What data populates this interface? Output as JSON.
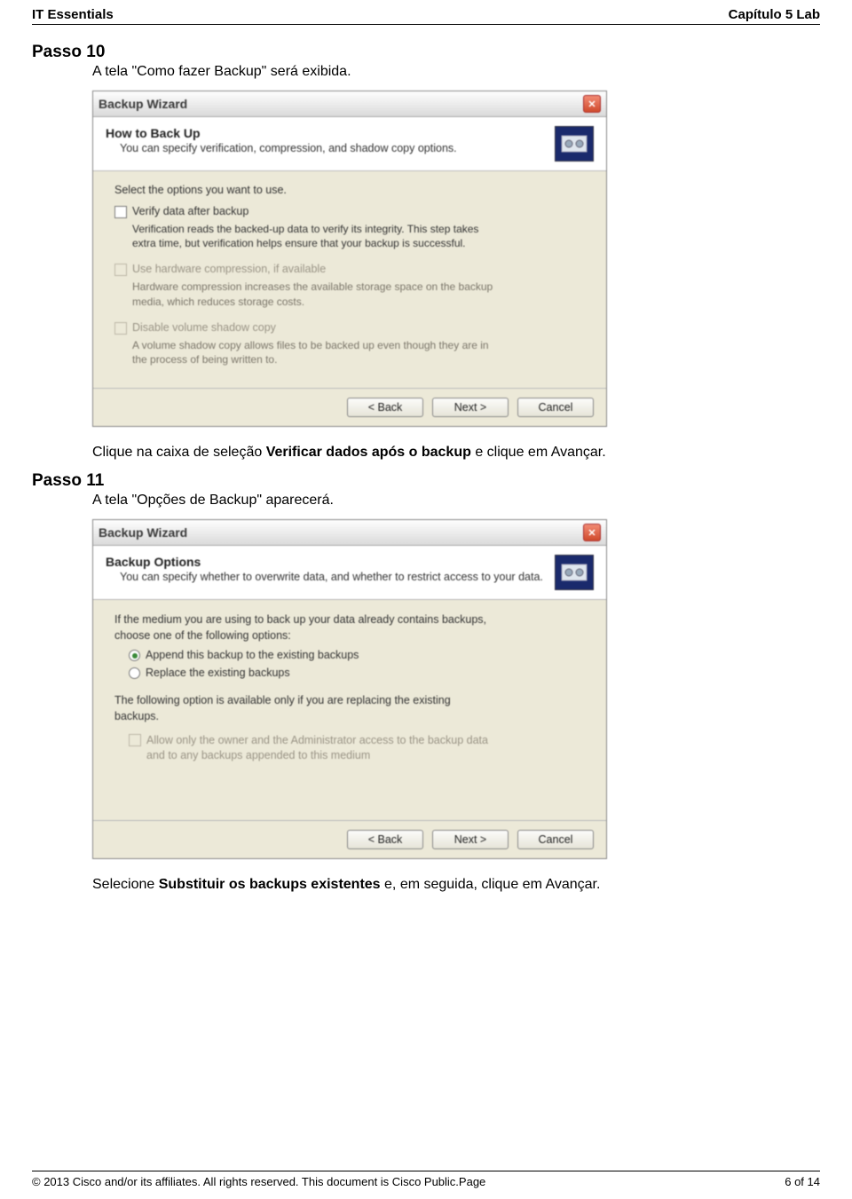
{
  "header": {
    "left": "IT Essentials",
    "right": "Capítulo 5 Lab"
  },
  "step10": {
    "heading": "Passo 10",
    "text": "A tela \"Como fazer Backup\" será exibida.",
    "after_prefix": "Clique na caixa de seleção ",
    "after_bold": "Verificar dados após o backup",
    "after_suffix": " e clique em Avançar."
  },
  "dialog1": {
    "title": "Backup Wizard",
    "banner_title": "How to Back Up",
    "banner_sub": "You can specify verification, compression, and shadow copy options.",
    "intro": "Select the options you want to use.",
    "opt1_label": "Verify data after backup",
    "opt1_desc": "Verification reads the backed-up data to verify its integrity. This step takes extra time, but verification helps ensure that your backup is successful.",
    "opt2_label": "Use hardware compression, if available",
    "opt2_desc": "Hardware compression increases the available storage space on the backup media, which reduces storage costs.",
    "opt3_label": "Disable volume shadow copy",
    "opt3_desc": "A volume shadow copy allows files to be backed up even though they are in the process of being written to.",
    "btn_back": "< Back",
    "btn_next": "Next >",
    "btn_cancel": "Cancel"
  },
  "step11": {
    "heading": "Passo 11",
    "text": "A tela \"Opções de Backup\" aparecerá.",
    "after_prefix": "Selecione ",
    "after_bold": "Substituir os backups existentes",
    "after_suffix": " e, em seguida, clique em Avançar."
  },
  "dialog2": {
    "title": "Backup Wizard",
    "banner_title": "Backup Options",
    "banner_sub": "You can specify whether to overwrite data, and whether to restrict access to your data.",
    "intro": "If the medium you are using to back up your data already contains backups, choose one of the following options:",
    "radio1": "Append this backup to the existing backups",
    "radio2": "Replace the existing backups",
    "mid": "The following option is available only if you are replacing the existing backups.",
    "chk_label": "Allow only the owner and the Administrator access to the backup data and to any backups appended to this medium",
    "btn_back": "< Back",
    "btn_next": "Next >",
    "btn_cancel": "Cancel"
  },
  "footer": {
    "left": "© 2013 Cisco and/or its affiliates. All rights reserved. This document is Cisco Public.Page",
    "right": "6 of 14"
  }
}
